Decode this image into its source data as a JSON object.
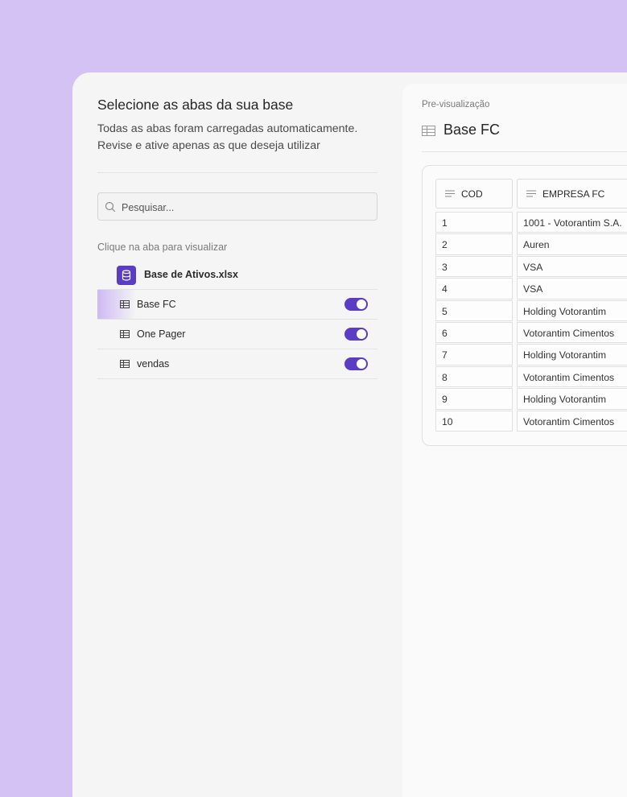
{
  "left": {
    "title": "Selecione as abas da sua base",
    "subtitle_line1": "Todas as abas foram carregadas automaticamente.",
    "subtitle_line2": "Revise e ative apenas as que deseja utilizar",
    "search": {
      "placeholder": "Pesquisar...",
      "value": ""
    },
    "hint": "Clique na aba para visualizar",
    "file": {
      "name": "Base de Ativos.xlsx",
      "icon": "database-icon"
    },
    "sheets": [
      {
        "label": "Base FC",
        "enabled": true,
        "active": true
      },
      {
        "label": "One Pager",
        "enabled": true,
        "active": false
      },
      {
        "label": "vendas",
        "enabled": true,
        "active": false
      }
    ]
  },
  "preview": {
    "caption": "Pre-visualização",
    "sheet_name": "Base FC",
    "columns": [
      "COD",
      "EMPRESA FC"
    ],
    "rows": [
      [
        "1",
        "1001 - Votorantim S.A."
      ],
      [
        "2",
        "Auren"
      ],
      [
        "3",
        "VSA"
      ],
      [
        "4",
        "VSA"
      ],
      [
        "5",
        "Holding Votorantim"
      ],
      [
        "6",
        "Votorantim Cimentos"
      ],
      [
        "7",
        "Holding Votorantim"
      ],
      [
        "8",
        "Votorantim Cimentos"
      ],
      [
        "9",
        "Holding Votorantim"
      ],
      [
        "10",
        "Votorantim Cimentos"
      ]
    ]
  },
  "colors": {
    "background": "#d3c2f3",
    "accent": "#5b3cc4",
    "panel": "#f5f5f5"
  }
}
